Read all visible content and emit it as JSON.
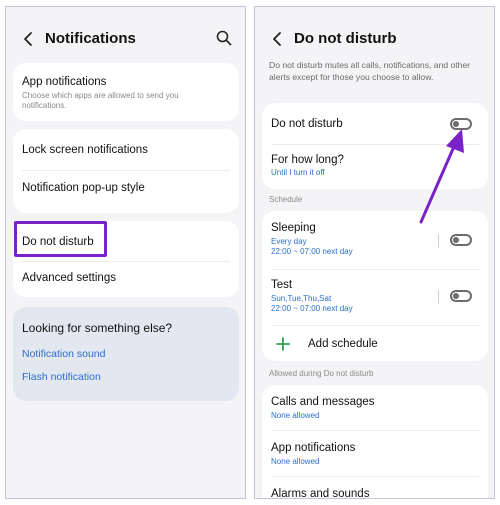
{
  "left": {
    "header": {
      "title": "Notifications",
      "back_icon": "back-icon",
      "search_icon": "search-icon"
    },
    "items": {
      "app_notifications": {
        "title": "App notifications",
        "subtitle": "Choose which apps are allowed to send you notifications."
      },
      "lock_screen": {
        "title": "Lock screen notifications"
      },
      "popup_style": {
        "title": "Notification pop-up style"
      },
      "do_not_disturb": {
        "title": "Do not disturb"
      },
      "advanced": {
        "title": "Advanced settings"
      }
    },
    "suggestions": {
      "heading": "Looking for something else?",
      "links": [
        "Notification sound",
        "Flash notification"
      ]
    },
    "highlight_color": "#7a22c9"
  },
  "right": {
    "header": {
      "title": "Do not disturb",
      "back_icon": "back-icon"
    },
    "description": "Do not disturb mutes all calls, notifications, and other alerts except for those you choose to allow.",
    "dnd": {
      "title": "Do not disturb",
      "enabled": false
    },
    "duration": {
      "title": "For how long?",
      "value": "Until I turn it off"
    },
    "schedule_label": "Schedule",
    "schedules": [
      {
        "name": "Sleeping",
        "days": "Every day",
        "time": "22:00 ~ 07:00 next day",
        "enabled": false
      },
      {
        "name": "Test",
        "days": "Sun,Tue,Thu,Sat",
        "time": "22:00 ~ 07:00 next day",
        "enabled": false
      }
    ],
    "add_schedule": "Add schedule",
    "allowed_label": "Allowed during Do not disturb",
    "allowed": [
      {
        "title": "Calls and messages",
        "value": "None allowed"
      },
      {
        "title": "App notifications",
        "value": "None allowed"
      },
      {
        "title": "Alarms and sounds"
      }
    ],
    "arrow_color": "#7a22c9"
  },
  "colors": {
    "accent_link": "#2a6fcf",
    "panel_bg": "#f4f4f6",
    "add_green": "#2e9e4f"
  }
}
